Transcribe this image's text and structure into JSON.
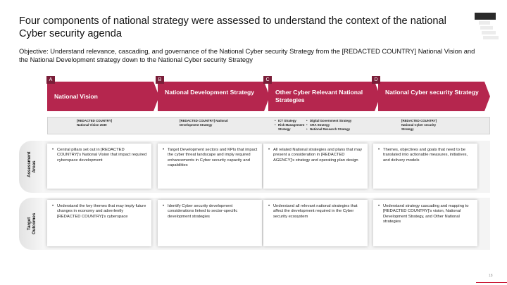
{
  "title": "Four components of national strategy were assessed to understand the context of the national Cyber security agenda",
  "objective": "Objective: Understand relevance, cascading, and governance of the National Cyber security Strategy from the [REDACTED COUNTRY] National Vision and the National Development strategy down to the National Cyber security Strategy",
  "columns": [
    {
      "letter": "A",
      "header": "National Vision",
      "docs": [
        "[REDACTED COUNTRY]",
        "National Vision 2030"
      ]
    },
    {
      "letter": "B",
      "header": "National Development Strategy",
      "docs": [
        "[REDACTED COUNTRY] National",
        "Development Strategy"
      ]
    },
    {
      "letter": "C",
      "header": "Other Cyber Relevant National Strategies",
      "docs_left": [
        "ICT Strategy",
        "Risk Management Strategy"
      ],
      "docs_right": [
        "Digital Government Strategy",
        "CRA Strategy",
        "National Research Strategy"
      ]
    },
    {
      "letter": "D",
      "header": "National Cyber security Strategy",
      "docs": [
        "[REDACTED COUNTRY]",
        "National Cyber security",
        "Strategy"
      ]
    }
  ],
  "rows": [
    {
      "label": "Assessment Areas",
      "cells": [
        "Central pillars set out in [REDACTED COUNTRY]'s National Vision that impact required cyberspace development",
        "Target Development sectors and KPIs that impact the cyber threat landscape and imply required enhancements in Cyber security capacity and capabilities",
        "All related National strategies and plans that may present a consideration in [REDACTED AGENCY]'s strategy and operating plan design",
        "Themes, objectives and goals that need to be translated into actionable measures, initiatives, and delivery models"
      ]
    },
    {
      "label": "Target Outcomes",
      "cells": [
        "Understand the key themes that may imply future changes in economy and adverlently [REDACTED COUNTRY]'s cyberspace",
        "Identify Cyber security development considerations linked to sector-specific development strategies",
        "Understand all relevant national strategies that affect the development required in the Cyber security ecosystem",
        "Understand strategy cascading and mapping to [REDACTED COUNTRY]'s vision, National Development Strategy, and Other National strategies"
      ]
    }
  ],
  "page_number": "18",
  "colors": {
    "accent": "#b5264e",
    "letter_bg": "#7a1d38"
  }
}
